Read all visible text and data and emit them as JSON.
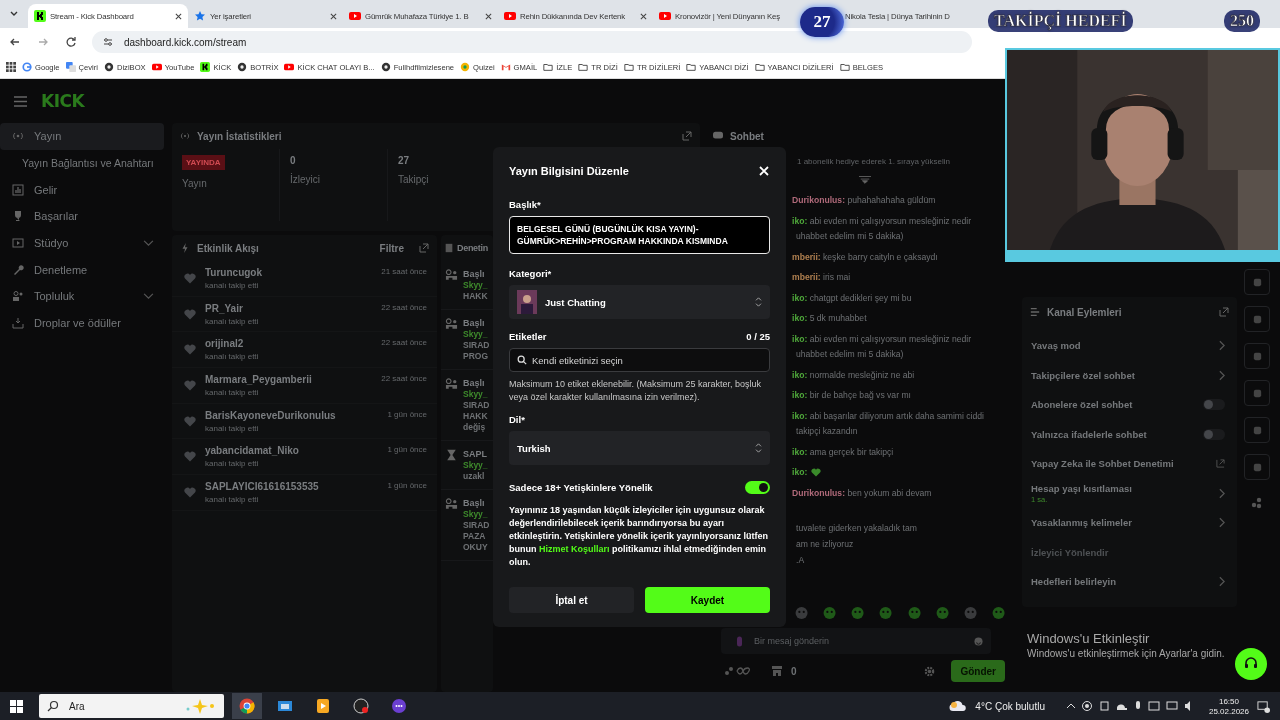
{
  "browser": {
    "tabs": [
      {
        "title": "Stream - Kick Dashboard",
        "selected": true,
        "kind": "kick"
      },
      {
        "title": "Yer işaretleri",
        "selected": false,
        "kind": "star"
      },
      {
        "title": "Gümrük Muhafaza Türkiye 1. B",
        "selected": false,
        "kind": "youtube"
      },
      {
        "title": "Rehin Dükkanında Dev Kertenk",
        "selected": false,
        "kind": "youtube"
      },
      {
        "title": "Kronovizör | Yeni Dünyanın Keş",
        "selected": false,
        "kind": "youtube"
      },
      {
        "title": "Nikola Tesla | Dünya Tarihinin D",
        "selected": false,
        "kind": "none"
      }
    ],
    "address": "dashboard.kick.com/stream",
    "bookmarks": [
      {
        "label": "Google",
        "kind": "google"
      },
      {
        "label": "Çeviri",
        "kind": "translate"
      },
      {
        "label": "DiziBOX",
        "kind": "tv"
      },
      {
        "label": "YouTube",
        "kind": "youtube"
      },
      {
        "label": "KİCK",
        "kind": "kick"
      },
      {
        "label": "BOTRİX",
        "kind": "bot"
      },
      {
        "label": "KİCK CHAT OLAYI B...",
        "kind": "youtube"
      },
      {
        "label": "Fullhdfilmizlesene",
        "kind": "reel"
      },
      {
        "label": "Quizei",
        "kind": "quiz"
      },
      {
        "label": "GMAİL",
        "kind": "gmail"
      },
      {
        "label": "İZLE",
        "kind": "folder"
      },
      {
        "label": "TR DİZİ",
        "kind": "folder"
      },
      {
        "label": "TR DİZİLERİ",
        "kind": "folder"
      },
      {
        "label": "YABANCI DİZİ",
        "kind": "folder"
      },
      {
        "label": "YABANCI DİZİLERİ",
        "kind": "folder"
      },
      {
        "label": "BELGES",
        "kind": "folder"
      }
    ]
  },
  "goal_overlay": {
    "current": "27",
    "title": "TAKİPÇİ HEDEFİ",
    "target": "250"
  },
  "sidebar": {
    "logo": "KICK",
    "items": [
      {
        "label": "Yayın",
        "kind": "broadcast",
        "selected": true,
        "expandable": false
      },
      {
        "label": "Yayın Bağlantısı ve Anahtarı",
        "kind": "sub",
        "selected": false,
        "expandable": false
      },
      {
        "label": "Gelir",
        "kind": "chart",
        "selected": false,
        "expandable": false
      },
      {
        "label": "Başarılar",
        "kind": "trophy",
        "selected": false,
        "expandable": false
      },
      {
        "label": "Stüdyo",
        "kind": "studio",
        "selected": false,
        "expandable": true
      },
      {
        "label": "Denetleme",
        "kind": "wrench",
        "selected": false,
        "expandable": false
      },
      {
        "label": "Topluluk",
        "kind": "people",
        "selected": false,
        "expandable": true
      },
      {
        "label": "Droplar ve ödüller",
        "kind": "drop",
        "selected": false,
        "expandable": false
      }
    ]
  },
  "stats": {
    "title": "Yayın İstatistikleri",
    "status_badge": "YAYINDA",
    "status_label": "Yayın",
    "cells": [
      {
        "value": "0",
        "label": "İzleyici"
      },
      {
        "value": "27",
        "label": "Takipçi"
      }
    ]
  },
  "activity": {
    "title": "Etkinlik Akışı",
    "filter": "Filtre",
    "events": [
      {
        "user": "Turuncugok",
        "action": "kanalı takip etti",
        "time": "21 saat önce"
      },
      {
        "user": "PR_Yair",
        "action": "kanalı takip etti",
        "time": "22 saat önce"
      },
      {
        "user": "orijinal2",
        "action": "kanalı takip etti",
        "time": "22 saat önce"
      },
      {
        "user": "Marmara_Peygamberii",
        "action": "kanalı takip etti",
        "time": "22 saat önce"
      },
      {
        "user": "BarisKayoneveDurikonulus",
        "action": "kanalı takip etti",
        "time": "1 gün önce"
      },
      {
        "user": "yabancidamat_Niko",
        "action": "kanalı takip etti",
        "time": "1 gün önce"
      },
      {
        "user": "SAPLAYICI61616153535",
        "action": "kanalı takip etti",
        "time": "1 gün önce"
      }
    ]
  },
  "moderation": {
    "title": "Denetin",
    "entries": [
      {
        "kind": "user",
        "title": "Başlı",
        "author": "Skyy_",
        "details": [
          "HAKK"
        ]
      },
      {
        "kind": "user",
        "title": "Başlı",
        "author": "Skyy_",
        "details": [
          "SIRAD",
          "PROG"
        ]
      },
      {
        "kind": "user",
        "title": "Başlı",
        "author": "Skyy_",
        "details": [
          "SIRAD",
          "HAKK",
          "değiş"
        ]
      },
      {
        "kind": "timer",
        "title": "SAPL",
        "author": "Skyy_",
        "details": [
          "uzakl"
        ]
      },
      {
        "kind": "user",
        "title": "Başlı",
        "author": "Skyy_",
        "details": [
          "SIRAD",
          "PAZA",
          "OKUY"
        ]
      }
    ]
  },
  "chat": {
    "title": "Sohbet",
    "pinned": "1 abonelik hediye ederek 1. sıraya yükselin",
    "messages": [
      {
        "kind": "text",
        "user": "Durikonulus:",
        "color": "#b06a7a",
        "text": "puhahahahaha güldüm"
      },
      {
        "kind": "text",
        "user": "iko:",
        "color": "#4fa83a",
        "text": "abi evden mi çalışıyorsun mesleğiniz nedir"
      },
      {
        "kind": "text",
        "text": "uhabbet edelim mi 5 dakika)"
      },
      {
        "kind": "text",
        "user": "mberii:",
        "color": "#b08050",
        "text": "keşke barry caityln e çaksaydı"
      },
      {
        "kind": "text",
        "user": "mberii:",
        "color": "#b08050",
        "text": "iris mai"
      },
      {
        "kind": "text",
        "user": "iko:",
        "color": "#4fa83a",
        "text": "chatgpt dedikleri şey mi bu"
      },
      {
        "kind": "text",
        "user": "iko:",
        "color": "#4fa83a",
        "text": "5 dk muhabbet"
      },
      {
        "kind": "text",
        "user": "iko:",
        "color": "#4fa83a",
        "text": "abi evden mi çalışıyorsun mesleğiniz nedir"
      },
      {
        "kind": "text",
        "text": "uhabbet edelim mi 5 dakika)"
      },
      {
        "kind": "text",
        "user": "iko:",
        "color": "#4fa83a",
        "text": "normalde mesleğiniz ne abi"
      },
      {
        "kind": "text",
        "user": "iko:",
        "color": "#4fa83a",
        "text": "bir de bahçe bağ vs var mı"
      },
      {
        "kind": "text",
        "user": "iko:",
        "color": "#4fa83a",
        "text": "abi başarılar diliyorum artık daha samimi ciddi"
      },
      {
        "kind": "text",
        "text": "takipçi kazandın"
      },
      {
        "kind": "text",
        "user": "iko:",
        "color": "#4fa83a",
        "text": "ama gerçek bir takipçi"
      },
      {
        "kind": "heart",
        "user": "iko:",
        "color": "#4fa83a"
      },
      {
        "kind": "text",
        "user": "Durikonulus:",
        "color": "#b06a7a",
        "text": "ben yokum abi devam"
      },
      {
        "kind": "gap"
      },
      {
        "kind": "text",
        "text": "tuvalete giderken yakaladık tam"
      },
      {
        "kind": "text",
        "text": "am ne izliyoruz"
      },
      {
        "kind": "text",
        "text": ".A"
      }
    ],
    "input_placeholder": "Bir mesaj gönderin",
    "points": "0",
    "send": "Gönder"
  },
  "channel_actions": {
    "title": "Kanal Eylemleri",
    "items": [
      {
        "kind": "chevron",
        "label": "Yavaş mod"
      },
      {
        "kind": "chevron",
        "label": "Takipçilere özel sohbet"
      },
      {
        "kind": "toggle",
        "label": "Abonelere özel sohbet",
        "on": false
      },
      {
        "kind": "toggle",
        "label": "Yalnızca ifadelerle sohbet",
        "on": false
      },
      {
        "kind": "external",
        "label": "Yapay Zeka ile Sohbet Denetimi"
      },
      {
        "kind": "chevron",
        "label": "Hesap yaşı kısıtlaması",
        "value": "1 sa."
      },
      {
        "kind": "chevron",
        "label": "Yasaklanmış kelimeler"
      },
      {
        "kind": "disabled",
        "label": "İzleyici Yönlendir"
      },
      {
        "kind": "chevron",
        "label": "Hedefleri belirleyin"
      }
    ]
  },
  "activation": {
    "title": "Windows'u Etkinleştir",
    "text": "Windows'u etkinleştirmek için Ayarlar'a gidin."
  },
  "dialog": {
    "title": "Yayın Bilgisini Düzenle",
    "title_label": "Başlık*",
    "title_value": "BELGESEL GÜNÜ (BUGÜNLÜK KISA YAYIN)-GÜMRÜK>REHİN>PROGRAM HAKKINDA KISMINDA",
    "category_label": "Kategori*",
    "category": "Just Chatting",
    "tags_label": "Etiketler",
    "tags_count": "0 / 25",
    "tags_placeholder": "Kendi etiketinizi seçin",
    "tags_help": "Maksimum 10 etiket eklenebilir. (Maksimum 25 karakter, boşluk veya özel karakter kullanılmasına izin verilmez).",
    "language_label": "Dil*",
    "language": "Turkish",
    "adult_label": "Sadece 18+ Yetişkinlere Yönelik",
    "adult_on": true,
    "adult_text_before": "Yayınınız 18 yaşından küçük izleyiciler için uygunsuz olarak değerlendirilebilecek içerik barındırıyorsa bu ayarı etkinleştirin. Yetişkinlere yönelik içerik yayınlıyorsanız lütfen bunun",
    "adult_link": "Hizmet Koşulları",
    "adult_text_after": "politikamızı ihlal etmediğinden emin olun.",
    "cancel": "İptal et",
    "save": "Kaydet"
  },
  "taskbar": {
    "search": "Ara",
    "weather": "4°C Çok bulutlu",
    "time": "16:50",
    "date": "25.02.2026"
  }
}
